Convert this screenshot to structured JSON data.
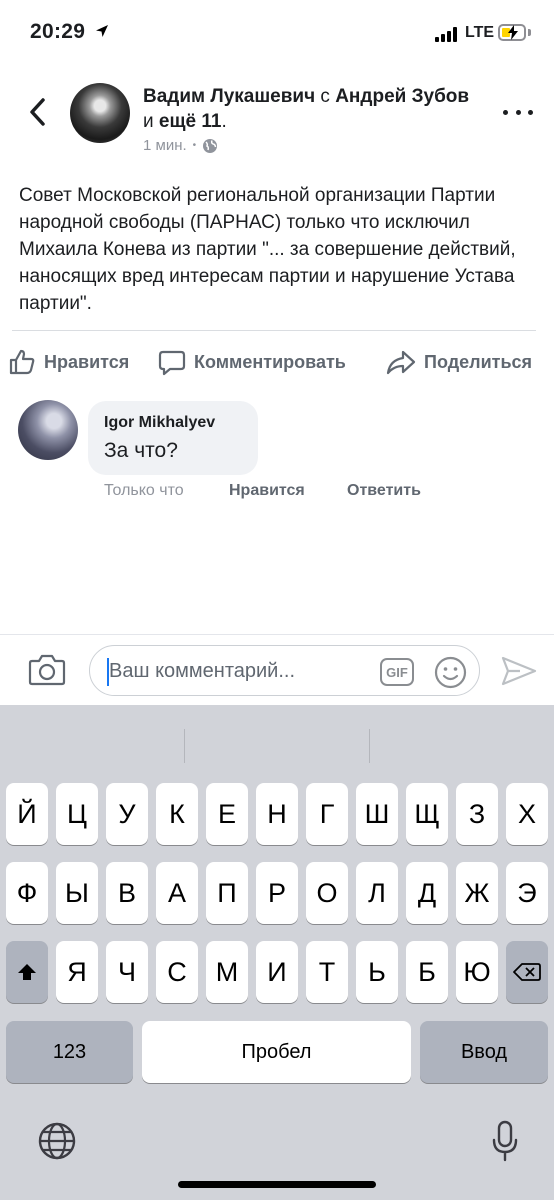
{
  "status_bar": {
    "time": "20:29",
    "network": "LTE",
    "location_icon": "location-arrow-icon",
    "battery_state": "charging"
  },
  "post": {
    "author": "Вадим Лукашевич",
    "with_word": " с ",
    "tagged": "Андрей Зубов",
    "and_word": " и ",
    "others": "ещё 11",
    "period": ".",
    "time": "1 мин.",
    "separator": "•",
    "privacy_icon": "globe-icon",
    "text": "Совет Московской региональной организации Партии народной свободы (ПАРНАС) только что исключил Михаила Конева из партии \"... за совершение действий, наносящих вред интересам партии и нарушение Устава партии\"."
  },
  "actions": {
    "like": "Нравится",
    "comment": "Комментировать",
    "share": "Поделиться"
  },
  "comment": {
    "author": "Igor Mikhalyev",
    "text": "За что?",
    "time": "Только что",
    "like": "Нравится",
    "reply": "Ответить"
  },
  "composer": {
    "placeholder": "Ваш комментарий...",
    "gif_label": "GIF"
  },
  "keyboard": {
    "row1": [
      "Й",
      "Ц",
      "У",
      "К",
      "Е",
      "Н",
      "Г",
      "Ш",
      "Щ",
      "З",
      "Х"
    ],
    "row2": [
      "Ф",
      "Ы",
      "В",
      "А",
      "П",
      "Р",
      "О",
      "Л",
      "Д",
      "Ж",
      "Э"
    ],
    "row3": [
      "Я",
      "Ч",
      "С",
      "М",
      "И",
      "Т",
      "Ь",
      "Б",
      "Ю"
    ],
    "numbers_key": "123",
    "space_key": "Пробел",
    "return_key": "Ввод"
  },
  "colors": {
    "accent": "#1877f2",
    "secondary_text": "#606770",
    "bubble": "#f0f2f5",
    "keyboard_bg": "#d1d3d9"
  }
}
